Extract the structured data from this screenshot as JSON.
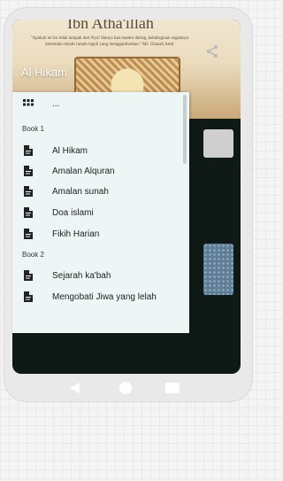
{
  "hero": {
    "title": "Ibn Atha'illah",
    "quote": "\"Apakah ini itu tidak tampak dari Nya? Hanya kan mantra dating, kebahagiaan segalanya kebetulan rumah rumah teguh yang menggambarkan.\" Mr. Ghazali Amir",
    "label": "Al Hikam"
  },
  "drawer": {
    "top_item": {
      "label": "...",
      "icon": "grid-icon"
    },
    "sections": [
      {
        "title": "Book 1",
        "items": [
          {
            "label": "Al Hikam",
            "icon": "document-icon"
          },
          {
            "label": "Amalan Alquran",
            "icon": "document-icon"
          },
          {
            "label": "Amalan sunah",
            "icon": "document-icon"
          },
          {
            "label": "Doa islami",
            "icon": "document-icon"
          },
          {
            "label": "Fikih Harian",
            "icon": "document-icon"
          }
        ]
      },
      {
        "title": "Book 2",
        "items": [
          {
            "label": "Sejarah ka'bah",
            "icon": "document-icon"
          },
          {
            "label": "Mengobati Jiwa yang lelah",
            "icon": "document-icon"
          }
        ]
      }
    ]
  },
  "colors": {
    "drawer_bg": "#eef5f5",
    "screen_bg": "#0f1a17",
    "phone_frame": "#e9e9e9"
  }
}
